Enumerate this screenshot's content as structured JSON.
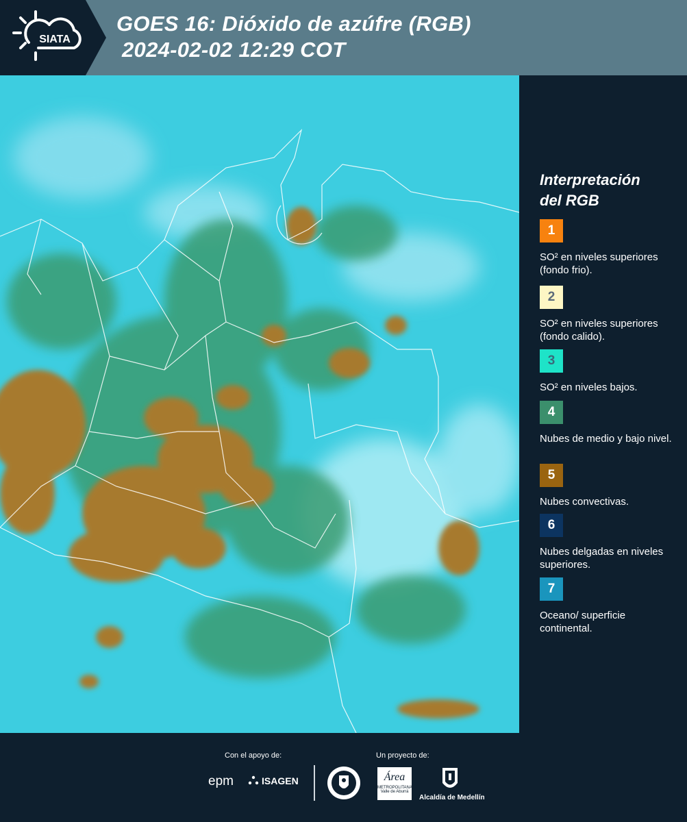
{
  "header": {
    "logo_text": "SIATA",
    "title_line1": "GOES 16: Dióxido de azúfre (RGB)",
    "title_line2": "2024-02-02 12:29 COT"
  },
  "legend": {
    "title_line1": "Interpretación",
    "title_line2": "del RGB",
    "items": [
      {
        "num": "1",
        "color": "#f7820f",
        "text_color": "#ffffff",
        "text": "SO² en niveles superiores (fondo frio)."
      },
      {
        "num": "2",
        "color": "#fdf6c4",
        "text_color": "#5a6a7a",
        "text": "SO² en niveles superiores (fondo calido)."
      },
      {
        "num": "3",
        "color": "#1ee3c8",
        "text_color": "#3a6a7a",
        "text": "SO² en niveles bajos."
      },
      {
        "num": "4",
        "color": "#3b8f6c",
        "text_color": "#ffffff",
        "text": "Nubes de medio y bajo nivel."
      },
      {
        "num": "5",
        "color": "#9a6410",
        "text_color": "#ffffff",
        "text": "Nubes convectivas."
      },
      {
        "num": "6",
        "color": "#0c3460",
        "text_color": "#ffffff",
        "text": "Nubes delgadas en niveles superiores."
      },
      {
        "num": "7",
        "color": "#1a95bd",
        "text_color": "#ffffff",
        "text": "Oceano/ superficie continental."
      }
    ]
  },
  "footer": {
    "support_label": "Con el apoyo de:",
    "project_label": "Un proyecto de:",
    "epm": "epm",
    "isagen": "ISAGEN",
    "area_line1": "METROPOLITANA",
    "area_line2": "Valle de Aburrá",
    "area_script": "Área",
    "alcaldia": "Alcaldía de Medellín"
  }
}
